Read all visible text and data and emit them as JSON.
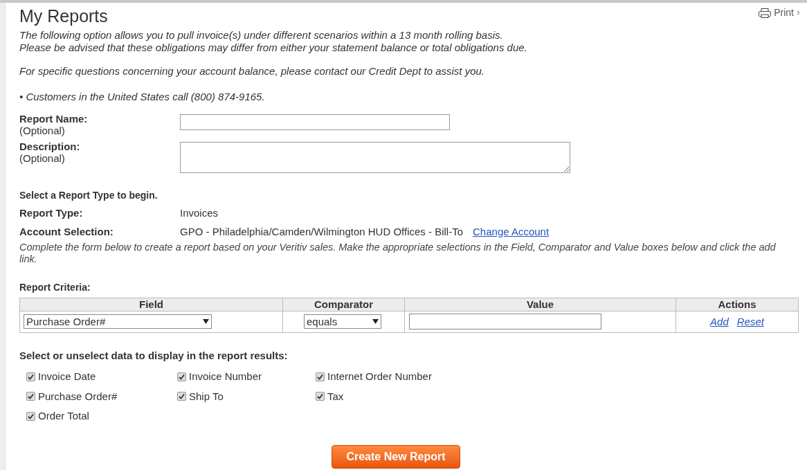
{
  "title": "My Reports",
  "print_link": "Print",
  "intro": [
    "The following option allows you to pull invoice(s) under different scenarios within a 13 month rolling basis.",
    "Please be advised that these obligations may differ from either your statement balance or total obligations due."
  ],
  "contact_note": "For specific questions concerning your account balance, please contact our Credit Dept to assist you.",
  "bullet": "• Customers in the United States call (800) 874-9165.",
  "fields": [
    {
      "label": "Report Name:",
      "hint": "(Optional)",
      "kind": "text"
    },
    {
      "label": "Description:",
      "hint": "(Optional)",
      "kind": "textarea"
    }
  ],
  "report_type_heading": "Select a Report Type to begin.",
  "report_type": {
    "label": "Report Type:",
    "value": "Invoices"
  },
  "account": {
    "label": "Account Selection:",
    "value": "GPO - Philadelphia/Camden/Wilmington HUD Offices - Bill-To",
    "link": "Change Account"
  },
  "instructions": "Complete the form below to create a report based on your Veritiv sales. Make the appropriate selections in the Field, Comparator and Value boxes below and click the add link.",
  "criteria": {
    "heading": "Report Criteria:",
    "columns": [
      "Field",
      "Comparator",
      "Value",
      "Actions"
    ],
    "field_value": "Purchase Order#",
    "comparator_value": "equals",
    "actions": [
      "Add",
      "Reset"
    ]
  },
  "display_heading": "Select or unselect data to display in the report results:",
  "display_options": [
    {
      "label": "Invoice Date",
      "checked": true
    },
    {
      "label": "Invoice Number",
      "checked": true
    },
    {
      "label": "Internet Order Number",
      "checked": true
    },
    {
      "label": "Purchase Order#",
      "checked": true
    },
    {
      "label": "Ship To",
      "checked": true
    },
    {
      "label": "Tax",
      "checked": true
    },
    {
      "label": "Order Total",
      "checked": true
    }
  ],
  "submit": "Create New Report"
}
